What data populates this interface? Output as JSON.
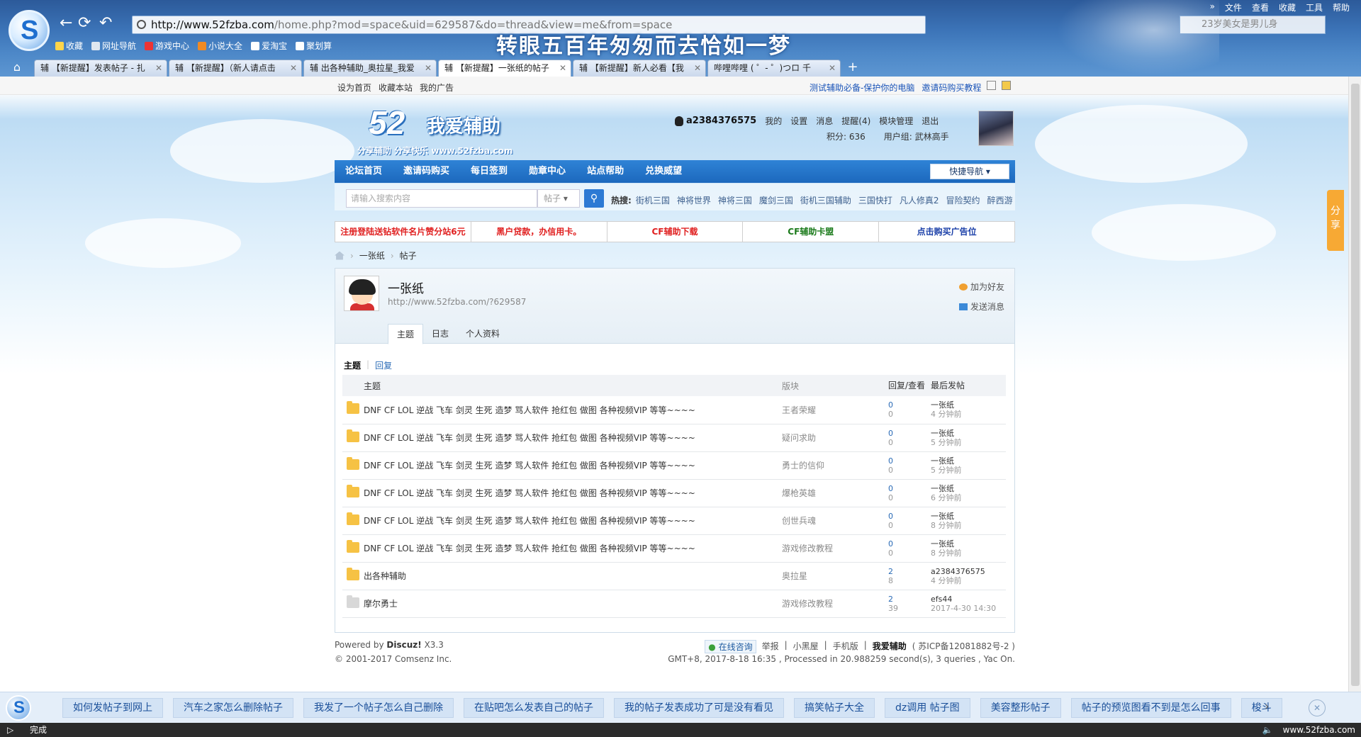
{
  "browser": {
    "url_host": "http://www.52fzba.com",
    "url_path": "/home.php?mod=space&uid=629587&do=thread&view=me&from=space",
    "search_placeholder": "23岁美女是男儿身",
    "menu": [
      "»",
      "文件",
      "查看",
      "收藏",
      "工具",
      "帮助"
    ],
    "banner": "转眼五百年匆匆而去恰如一梦",
    "bookmarks": [
      "收藏",
      "网址导航",
      "游戏中心",
      "小说大全",
      "爱淘宝",
      "聚划算"
    ],
    "tabs": [
      {
        "label": "辅 【新提醒】发表帖子 - 扎"
      },
      {
        "label": "辅 【新提醒】（新人请点击"
      },
      {
        "label": "辅 出各种辅助_奥拉星_我爱"
      },
      {
        "label": "辅 【新提醒】一张纸的帖子"
      },
      {
        "label": "辅 【新提醒】新人必看【我"
      },
      {
        "label": "哔哩哔哩 ( ゜- ゜)つロ 千"
      }
    ],
    "active_tab": 3
  },
  "topbar": {
    "left": [
      "设为首页",
      "收藏本站",
      "我的广告"
    ],
    "right": [
      "测试辅助必备-保护你的电脑",
      "邀请码购买教程"
    ]
  },
  "site": {
    "logo_num": "52",
    "logo_name": "我爱辅助",
    "slogan": "分享辅助  分享快乐  www.52fzba.com"
  },
  "user": {
    "name": "a2384376575",
    "links": [
      "我的",
      "设置",
      "消息",
      "提醒(4)",
      "模块管理",
      "退出"
    ],
    "points": "积分: 636",
    "group": "用户组: 武林高手"
  },
  "nav": {
    "items": [
      "论坛首页",
      "邀请码购买",
      "每日签到",
      "勋章中心",
      "站点帮助",
      "兑换威望"
    ],
    "quick": "快捷导航"
  },
  "search": {
    "placeholder": "请输入搜索内容",
    "type": "帖子",
    "hot_label": "热搜:",
    "hot": [
      "街机三国",
      "神将世界",
      "神将三国",
      "魔剑三国",
      "街机三国辅助",
      "三国快打",
      "凡人修真2",
      "冒险契约",
      "醉西游"
    ]
  },
  "ads": [
    {
      "text": "注册登陆送钻软件名片赞分站6元",
      "color": "#e02020"
    },
    {
      "text": "黑户贷款，办信用卡。",
      "color": "#e02020"
    },
    {
      "text": "CF辅助下载",
      "color": "#e02020"
    },
    {
      "text": "CF辅助卡盟",
      "color": "#1a7a1a"
    },
    {
      "text": "点击购买广告位",
      "color": "#1a3fa8"
    }
  ],
  "breadcrumb": [
    "一张纸",
    "帖子"
  ],
  "profile": {
    "name": "一张纸",
    "url": "http://www.52fzba.com/?629587",
    "add_friend": "加为好友",
    "send_message": "发送消息",
    "tabs": [
      "主题",
      "日志",
      "个人资料"
    ],
    "subtabs": [
      "主题",
      "回复"
    ]
  },
  "threads": {
    "headers": {
      "title": "主题",
      "forum": "版块",
      "stats": "回复/查看",
      "last": "最后发帖"
    },
    "rows": [
      {
        "title": "DNF CF LOL 逆战 飞车 剑灵 生死 造梦 骂人软件 抢红包 做图 各种视频VIP 等等~~~~",
        "forum": "王者荣耀",
        "replies": "0",
        "views": "0",
        "author": "一张纸",
        "time": "4 分钟前",
        "icon": "folder"
      },
      {
        "title": "DNF CF LOL 逆战 飞车 剑灵 生死 造梦 骂人软件 抢红包 做图 各种视频VIP 等等~~~~",
        "forum": "疑问求助",
        "replies": "0",
        "views": "0",
        "author": "一张纸",
        "time": "5 分钟前",
        "icon": "folder"
      },
      {
        "title": "DNF CF LOL 逆战 飞车 剑灵 生死 造梦 骂人软件 抢红包 做图 各种视频VIP 等等~~~~",
        "forum": "勇士的信仰",
        "replies": "0",
        "views": "0",
        "author": "一张纸",
        "time": "5 分钟前",
        "icon": "folder"
      },
      {
        "title": "DNF CF LOL 逆战 飞车 剑灵 生死 造梦 骂人软件 抢红包 做图 各种视频VIP 等等~~~~",
        "forum": "爆枪英雄",
        "replies": "0",
        "views": "0",
        "author": "一张纸",
        "time": "6 分钟前",
        "icon": "folder"
      },
      {
        "title": "DNF CF LOL 逆战 飞车 剑灵 生死 造梦 骂人软件 抢红包 做图 各种视频VIP 等等~~~~",
        "forum": "创世兵魂",
        "replies": "0",
        "views": "0",
        "author": "一张纸",
        "time": "8 分钟前",
        "icon": "folder"
      },
      {
        "title": "DNF CF LOL 逆战 飞车 剑灵 生死 造梦 骂人软件 抢红包 做图 各种视频VIP 等等~~~~",
        "forum": "游戏修改教程",
        "replies": "0",
        "views": "0",
        "author": "一张纸",
        "time": "8 分钟前",
        "icon": "folder"
      },
      {
        "title": "出各种辅助",
        "forum": "奥拉星",
        "replies": "2",
        "views": "8",
        "author": "a2384376575",
        "time": "4 分钟前",
        "icon": "folder"
      },
      {
        "title": "摩尔勇士",
        "forum": "游戏修改教程",
        "replies": "2",
        "views": "39",
        "author": "efs44",
        "time": "2017-4-30 14:30",
        "icon": "folder-grey"
      }
    ]
  },
  "footer": {
    "powered_prefix": "Powered by",
    "powered_name": "Discuz!",
    "powered_ver": "X3.3",
    "copyright": "© 2001-2017 Comsenz Inc.",
    "consult": "在线咨询",
    "links": [
      "举报",
      "小黑屋",
      "手机版"
    ],
    "site_name": "我爱辅助",
    "icp": "( 苏ICP备12081882号-2 )",
    "meta": "GMT+8, 2017-8-18 16:35 , Processed in 20.988259 second(s), 3 queries , Yac On."
  },
  "share_label": "分享",
  "suggestions": [
    "如何发帖子到网上",
    "汽车之家怎么删除帖子",
    "我发了一个帖子怎么自己删除",
    "在贴吧怎么发表自己的帖子",
    "我的帖子发表成功了可是没有看见",
    "搞笑帖子大全",
    "dz调用 帖子图",
    "美容整形帖子",
    "帖子的预览图看不到是怎么回事",
    "梭斗"
  ],
  "status": {
    "text": "完成",
    "watermark": "www.52fzba.com"
  },
  "colors": {
    "nav_blue": "#1c68bd",
    "link_blue": "#2a6bb6",
    "folder": "#f6c244",
    "share": "#f7a934"
  }
}
